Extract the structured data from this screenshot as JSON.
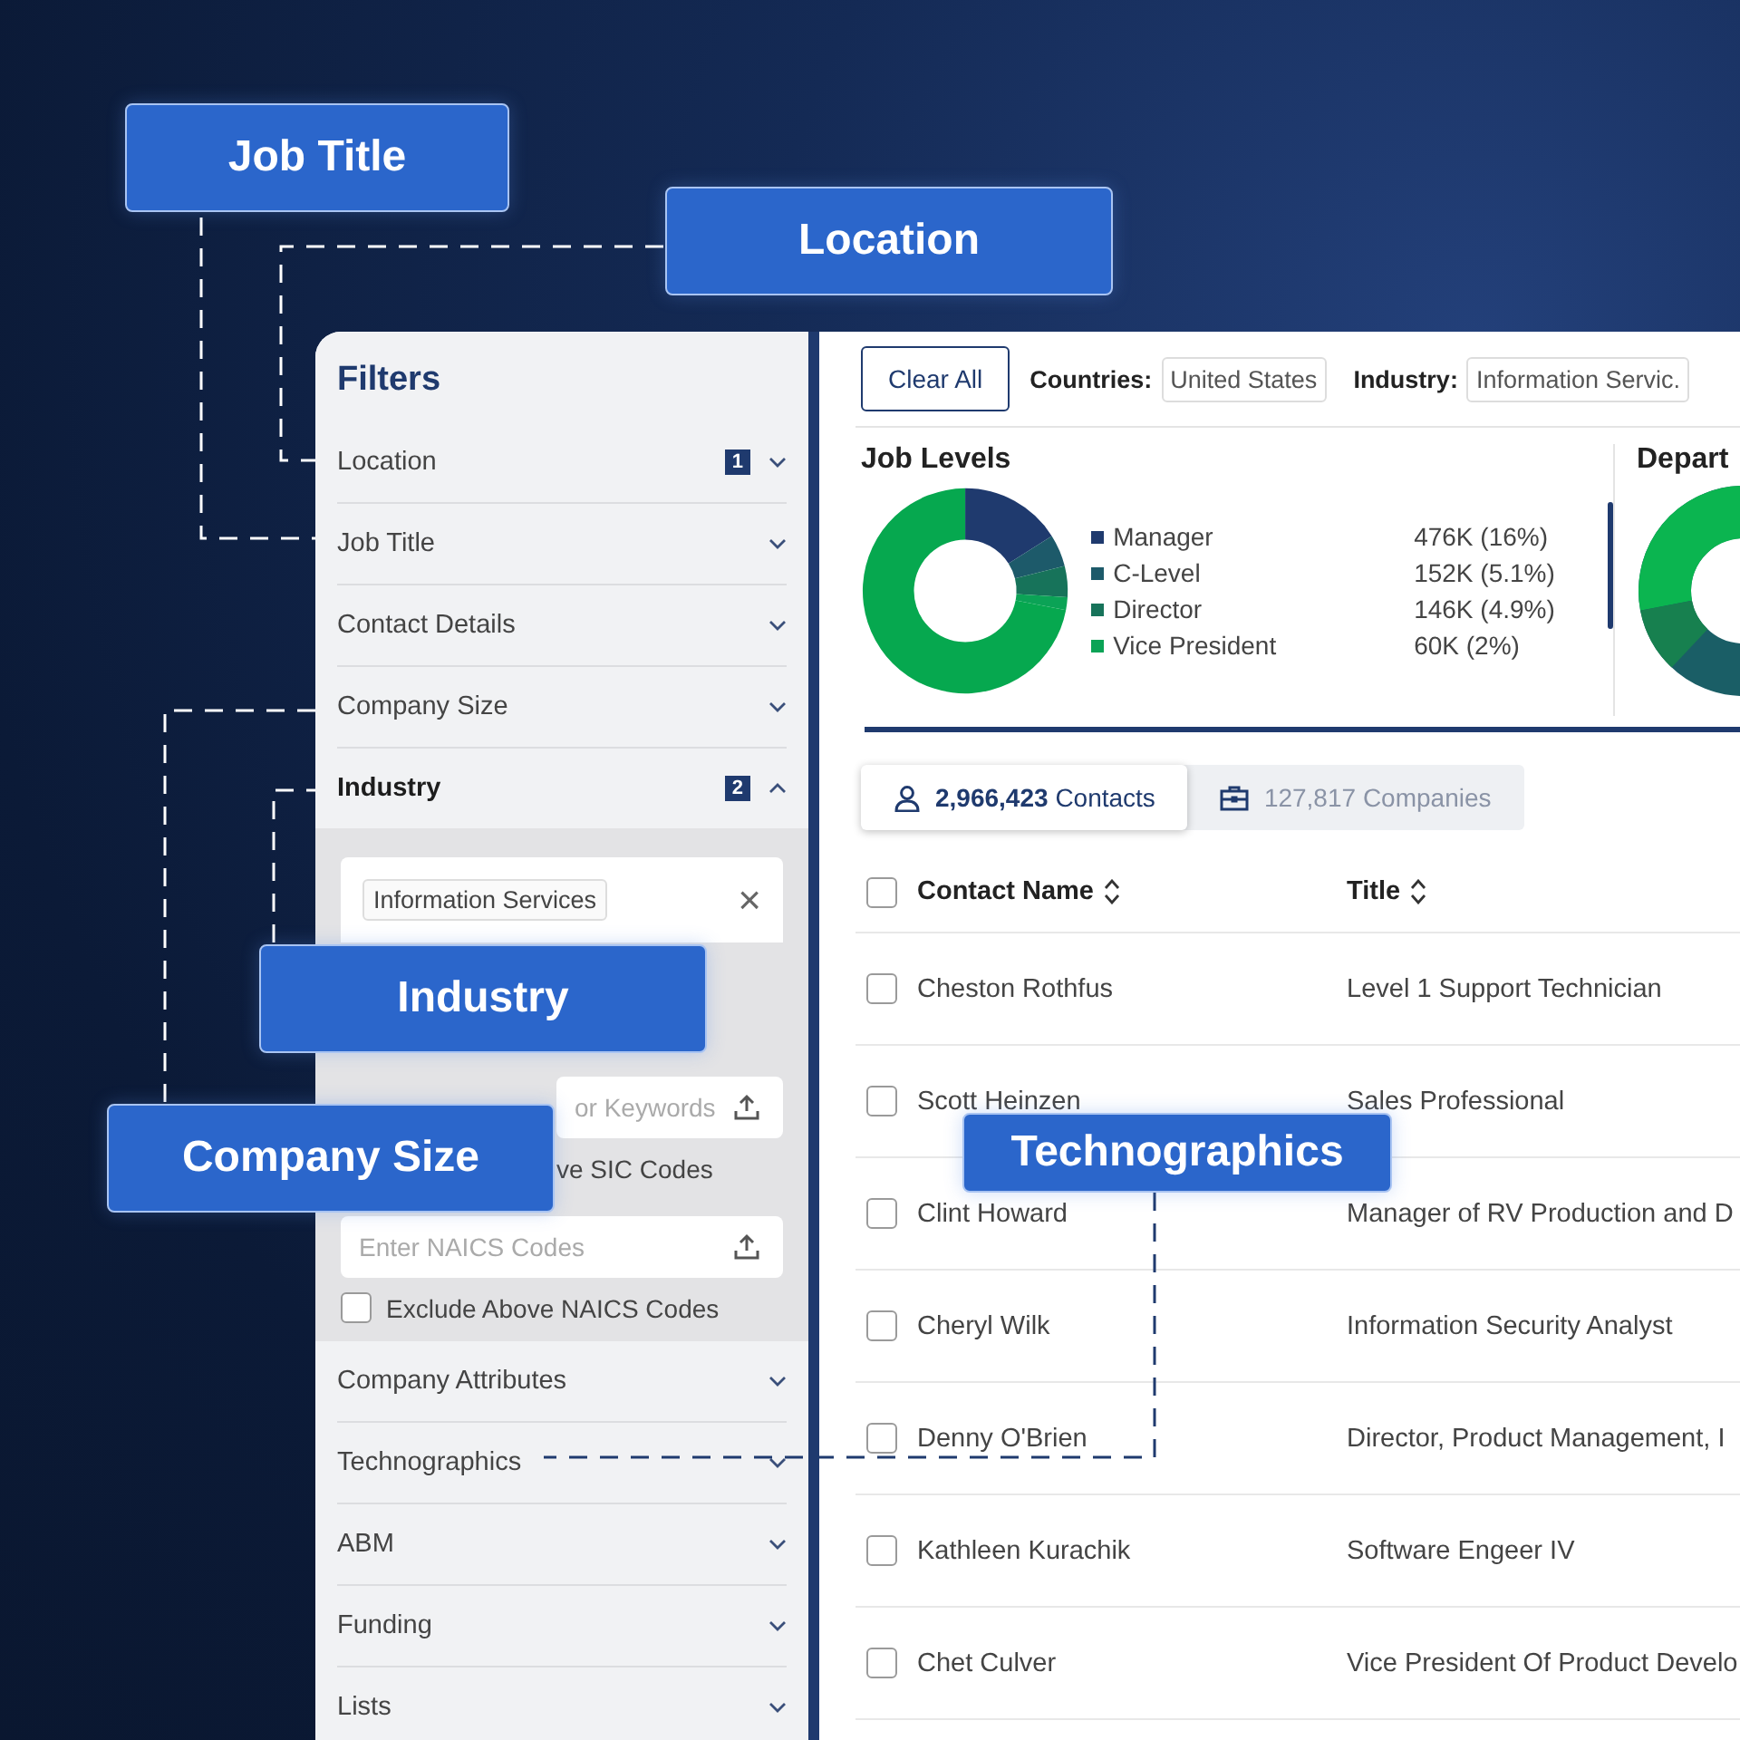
{
  "sidebar": {
    "title": "Filters",
    "items": [
      {
        "label": "Location",
        "badge": "1",
        "expanded": false
      },
      {
        "label": "Job Title",
        "expanded": false
      },
      {
        "label": "Contact Details",
        "expanded": false
      },
      {
        "label": "Company Size",
        "expanded": false
      },
      {
        "label": "Industry",
        "badge": "2",
        "expanded": true
      },
      {
        "label": "Company Attributes",
        "expanded": false
      },
      {
        "label": "Technographics",
        "expanded": false
      },
      {
        "label": "ABM",
        "expanded": false
      },
      {
        "label": "Funding",
        "expanded": false
      },
      {
        "label": "Lists",
        "expanded": false
      }
    ],
    "industry_panel": {
      "chips": [
        "Information Services"
      ],
      "clear": "×",
      "fields": [
        {
          "placeholder": "or Keywords",
          "exclude_label": "ve SIC Codes"
        },
        {
          "placeholder": "Enter NAICS Codes",
          "exclude_label": "Exclude Above NAICS Codes",
          "exclude_checked": false
        }
      ]
    }
  },
  "filter_bar": {
    "clear_button": "Clear All",
    "filters": [
      {
        "label": "Countries:",
        "value": "United States"
      },
      {
        "label": "Industry:",
        "value": "Information Servic."
      }
    ]
  },
  "job_levels": {
    "title": "Job Levels",
    "legend": [
      {
        "label": "Manager",
        "reading": "476K (16%)",
        "color": "#1f3a6e"
      },
      {
        "label": "C-Level",
        "reading": "152K (5.1%)",
        "color": "#1d5a6a"
      },
      {
        "label": "Director",
        "reading": "146K (4.9%)",
        "color": "#17735a"
      },
      {
        "label": "Vice President",
        "reading": "60K (2%)",
        "color": "#0ba356"
      }
    ]
  },
  "departments": {
    "title": "Depart"
  },
  "tabs": [
    {
      "count": "2,966,423",
      "label": "Contacts",
      "kind": "person",
      "selected": true
    },
    {
      "count": "127,817",
      "label": "Companies",
      "kind": "briefcase",
      "selected": false
    }
  ],
  "table": {
    "columns": [
      "Contact Name",
      "Title"
    ],
    "header_checked": false,
    "rows": [
      {
        "name": "Cheston Rothfus",
        "title": "Level 1 Support Technician",
        "checked": false
      },
      {
        "name": "Scott Heinzen",
        "title": "Sales Professional",
        "checked": false
      },
      {
        "name": "Clint Howard",
        "title": "Manager of RV Production and D",
        "checked": false
      },
      {
        "name": "Cheryl Wilk",
        "title": "Information Security Analyst",
        "checked": false
      },
      {
        "name": "Denny O'Brien",
        "title": "Director, Product Management, I",
        "checked": false
      },
      {
        "name": "Kathleen Kurachik",
        "title": "Software Engeer IV",
        "checked": false
      },
      {
        "name": "Chet Culver",
        "title": "Vice President Of Product Develo",
        "checked": false
      }
    ]
  },
  "callouts": [
    "Job Title",
    "Location",
    "Industry",
    "Company Size",
    "Technographics"
  ]
}
